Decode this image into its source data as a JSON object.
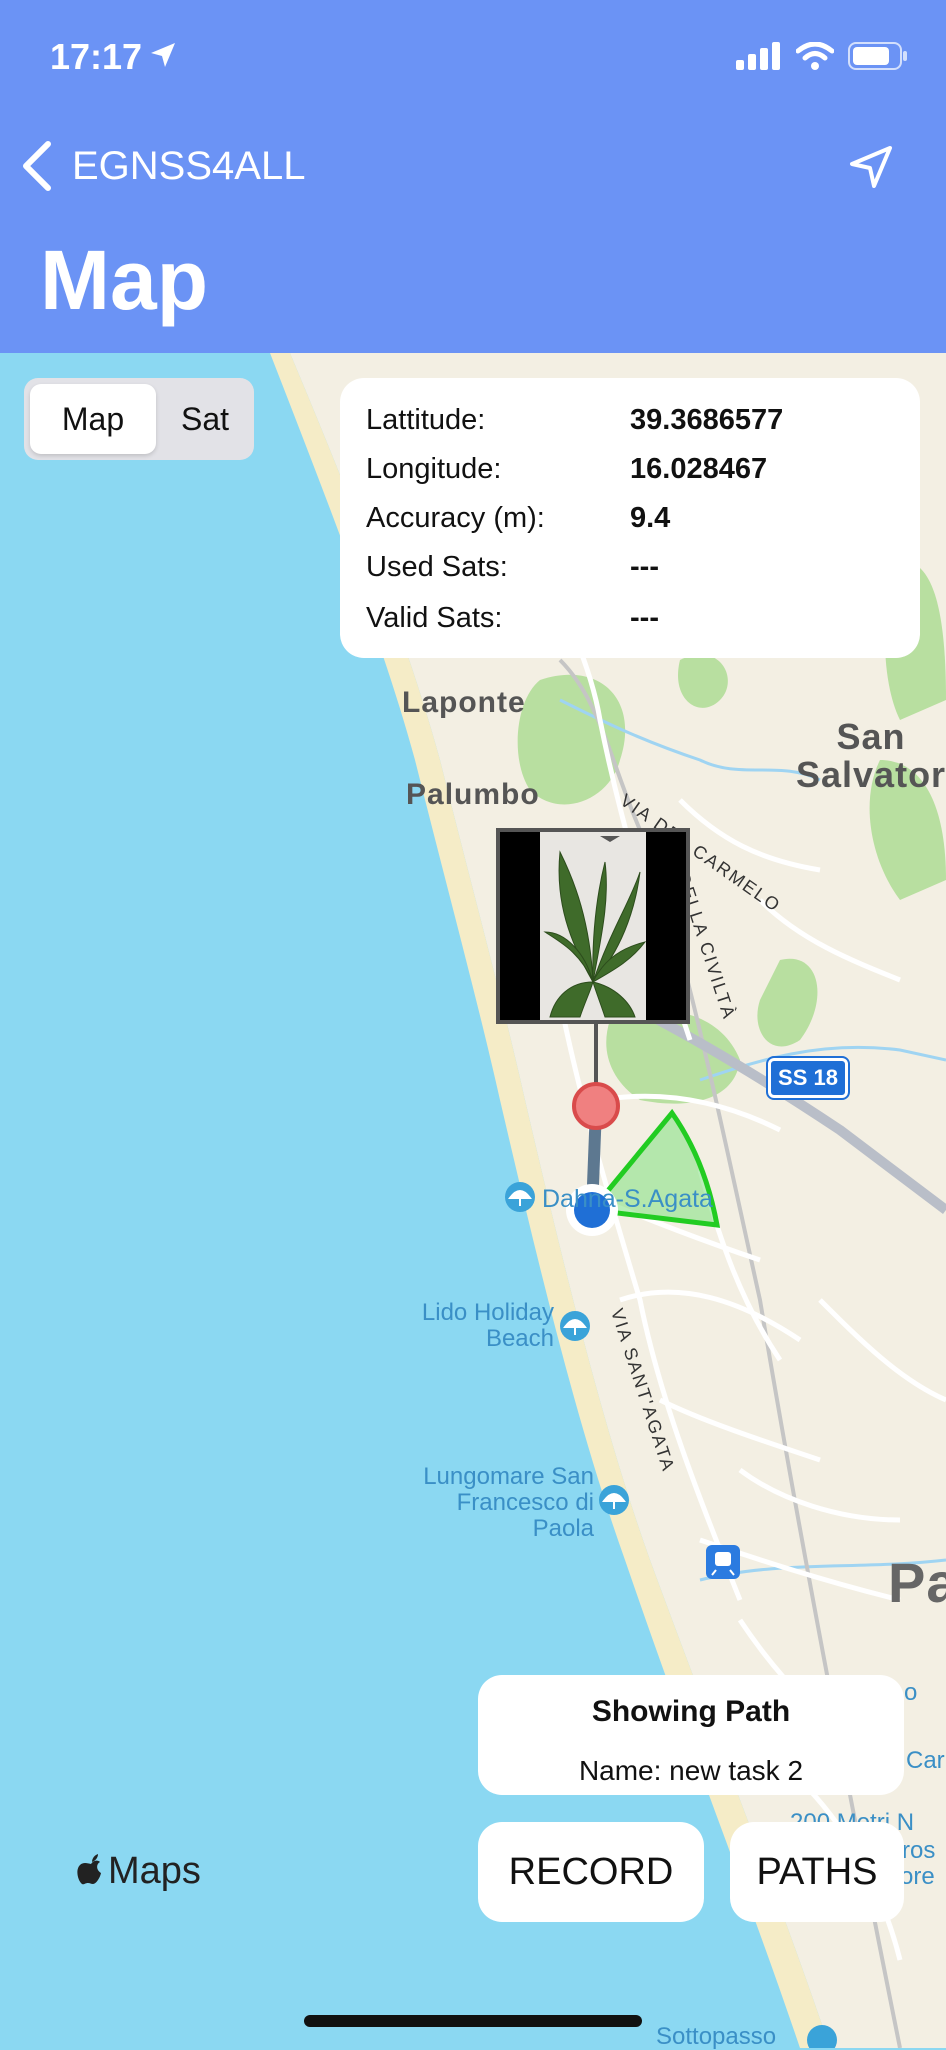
{
  "status": {
    "time": "17:17"
  },
  "nav": {
    "back_label": "EGNSS4ALL",
    "title": "Map"
  },
  "segmented": {
    "map_label": "Map",
    "sat_label": "Sat",
    "selected": "Map"
  },
  "info": {
    "lat_label": "Lattitude:",
    "lat_value": "39.3686577",
    "lon_label": "Longitude:",
    "lon_value": "16.028467",
    "acc_label": "Accuracy (m):",
    "acc_value": "9.4",
    "used_label": "Used Sats:",
    "used_value": "---",
    "valid_label": "Valid Sats:",
    "valid_value": "---"
  },
  "map_labels": {
    "laponte": "Laponte",
    "palumbo": "Palumbo",
    "san_salvatore": "San\nSalvator",
    "paola": "Pa",
    "dahna": "Dahna-S.Agata",
    "lido": "Lido Holiday\nBeach",
    "lungomare": "Lungomare San\nFrancesco di\nPaola",
    "sottopasso": "Sottopasso",
    "via_del_carmelo": "VIA DEL CARMELO",
    "della_civilta": "DELLA CIVILTÀ",
    "via_santagata": "VIA SANT'AGATA",
    "ss18": "SS 18",
    "edge_o": "o",
    "edge_car": "Car",
    "edge_metri": "200 Metri N",
    "edge_ros": "ros",
    "edge_ore": "ore"
  },
  "path_card": {
    "title": "Showing Path",
    "name": "Name: new task 2"
  },
  "buttons": {
    "record": "RECORD",
    "paths": "PATHS"
  },
  "maps_logo": "Maps",
  "colors": {
    "header": "#6b93f5",
    "sea": "#8bd8f2",
    "land": "#f3efe3",
    "park": "#b8dfa0",
    "accent_green": "#22cc22",
    "pin_red": "#f08080"
  },
  "icons": [
    "location-arrow-icon",
    "signal-icon",
    "wifi-icon",
    "battery-icon",
    "chevron-left-icon",
    "navigation-arrow-icon",
    "beach-umbrella-icon",
    "train-icon",
    "apple-icon"
  ]
}
